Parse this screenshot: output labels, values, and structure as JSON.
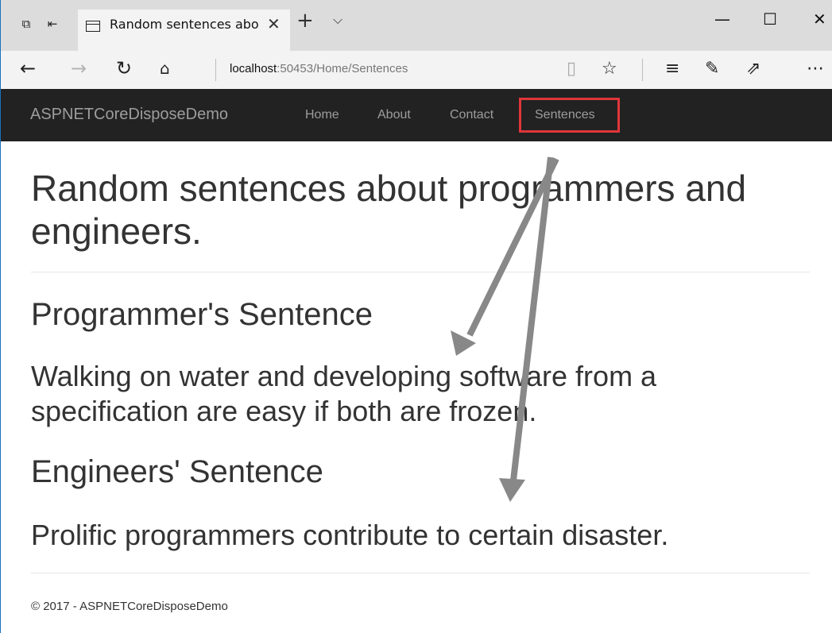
{
  "browser": {
    "tab_title": "Random sentences abo",
    "url_host": "localhost",
    "url_path": ":50453/Home/Sentences"
  },
  "site": {
    "brand": "ASPNETCoreDisposeDemo",
    "nav": [
      "Home",
      "About",
      "Contact",
      "Sentences"
    ]
  },
  "page": {
    "title": "Random sentences about programmers and engineers.",
    "programmer_heading": "Programmer's Sentence",
    "programmer_sentence": "Walking on water and developing software from a specification are easy if both are frozen.",
    "engineer_heading": "Engineers' Sentence",
    "engineer_sentence": "Prolific programmers contribute to certain disaster.",
    "footer": "© 2017 - ASPNETCoreDisposeDemo"
  },
  "colors": {
    "navbar_bg": "#222222",
    "highlight": "#e0363a",
    "arrow": "#888888"
  }
}
